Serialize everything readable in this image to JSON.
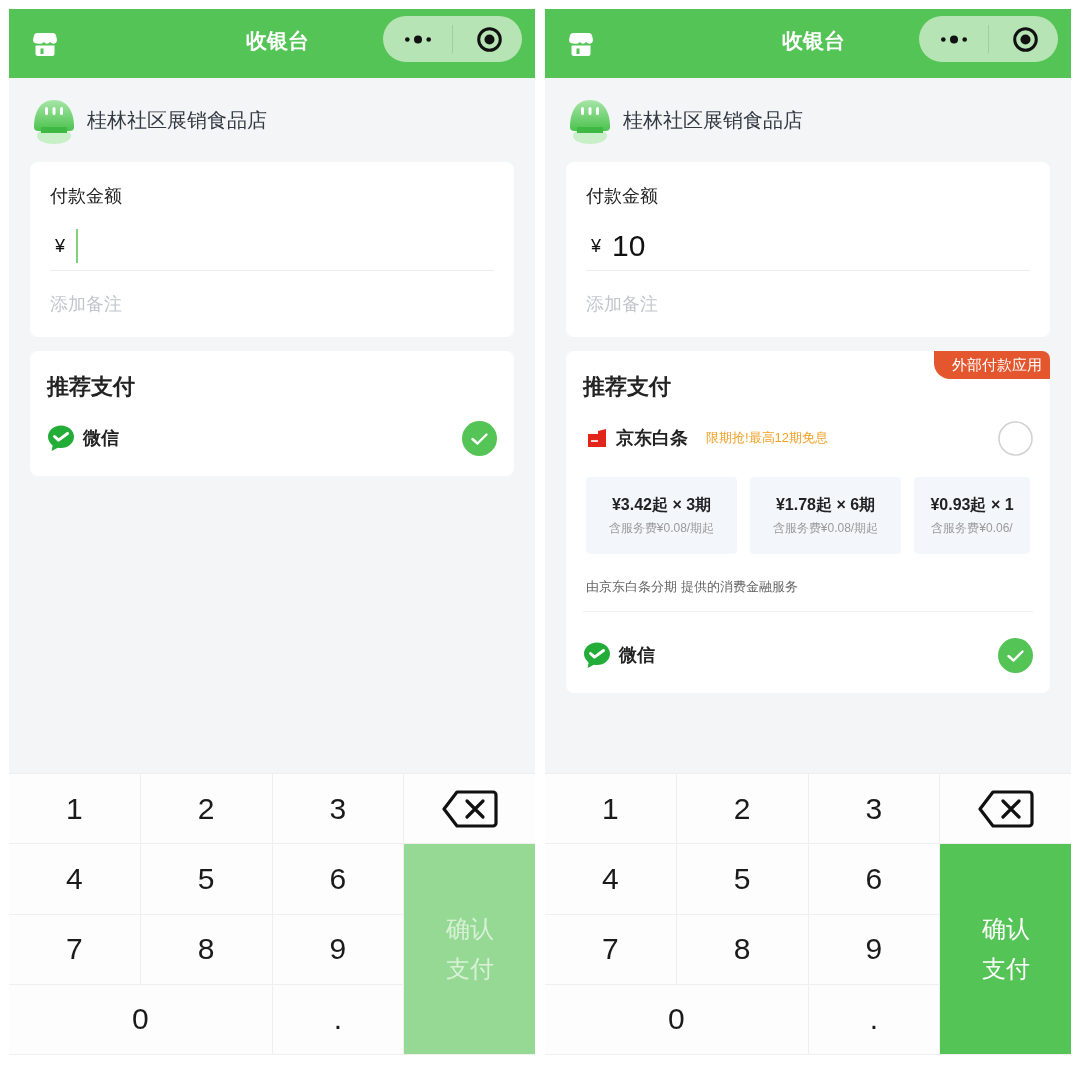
{
  "screens": [
    {
      "nav": {
        "title": "收银台"
      },
      "store": {
        "name": "桂林社区展销食品店"
      },
      "amount": {
        "label": "付款金额",
        "currency": "¥",
        "cursor": true,
        "note_placeholder": "添加备注"
      },
      "payment": {
        "title": "推荐支付",
        "methods": [
          {
            "kind": "wechat",
            "name": "微信",
            "selected": true
          }
        ]
      },
      "keypad": {
        "keys": [
          "1",
          "2",
          "3",
          "4",
          "5",
          "6",
          "7",
          "8",
          "9",
          "0",
          "."
        ],
        "confirm": {
          "label": "确认支付",
          "disabled": true
        }
      }
    },
    {
      "nav": {
        "title": "收银台"
      },
      "store": {
        "name": "桂林社区展销食品店"
      },
      "amount": {
        "label": "付款金额",
        "currency": "¥",
        "value": "10",
        "cursor": false,
        "note_placeholder": "添加备注"
      },
      "payment": {
        "title": "推荐支付",
        "badge": "外部付款应用",
        "methods": [
          {
            "kind": "jd",
            "name": "京东白条",
            "promo": "限期抢!最高12期免息",
            "selected": false,
            "plans": [
              {
                "price": "¥3.42起 × 3期",
                "fee": "含服务费¥0.08/期起"
              },
              {
                "price": "¥1.78起 × 6期",
                "fee": "含服务费¥0.08/期起"
              },
              {
                "price": "¥0.93起 × 1",
                "fee": "含服务费¥0.06/"
              }
            ],
            "footnote": "由京东白条分期 提供的消费金融服务"
          },
          {
            "kind": "wechat",
            "name": "微信",
            "selected": true
          }
        ]
      },
      "keypad": {
        "keys": [
          "1",
          "2",
          "3",
          "4",
          "5",
          "6",
          "7",
          "8",
          "9",
          "0",
          "."
        ],
        "confirm": {
          "label": "确认支付",
          "disabled": false
        }
      }
    }
  ]
}
